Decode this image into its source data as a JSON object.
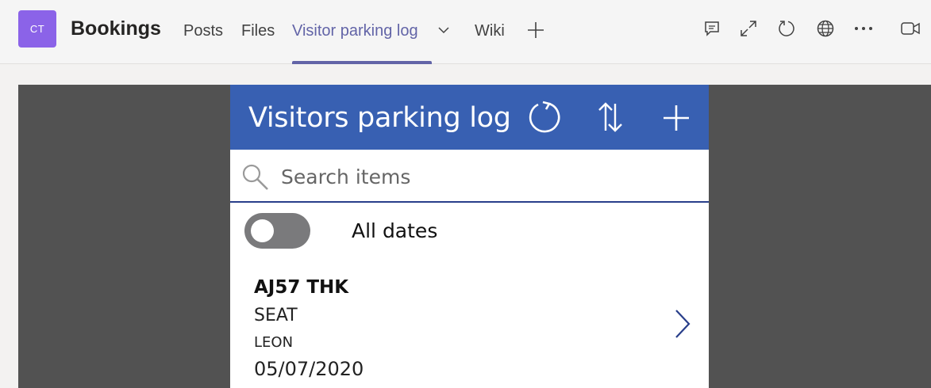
{
  "team": {
    "initials": "CT",
    "name": "Bookings"
  },
  "tabs": [
    {
      "label": "Posts"
    },
    {
      "label": "Files"
    },
    {
      "label": "Visitor parking log",
      "active": true
    },
    {
      "label": "Wiki"
    }
  ],
  "header_icons": [
    "conversation-icon",
    "expand-icon",
    "reload-icon",
    "globe-icon",
    "more-icon",
    "meet-icon"
  ],
  "app": {
    "title": "Visitors parking log",
    "buttons": [
      "refresh-icon",
      "sort-icon",
      "add-icon"
    ],
    "search": {
      "placeholder": "Search items",
      "value": ""
    },
    "toggle": {
      "label": "All dates",
      "on": false
    },
    "records": [
      {
        "registration": "AJ57 THK",
        "make": "SEAT",
        "model": "LEON",
        "date": "05/07/2020"
      }
    ]
  },
  "colors": {
    "accent": "#6264a7",
    "app_header": "#3860b2",
    "stage": "#525252",
    "avatar": "#8b63e8"
  }
}
